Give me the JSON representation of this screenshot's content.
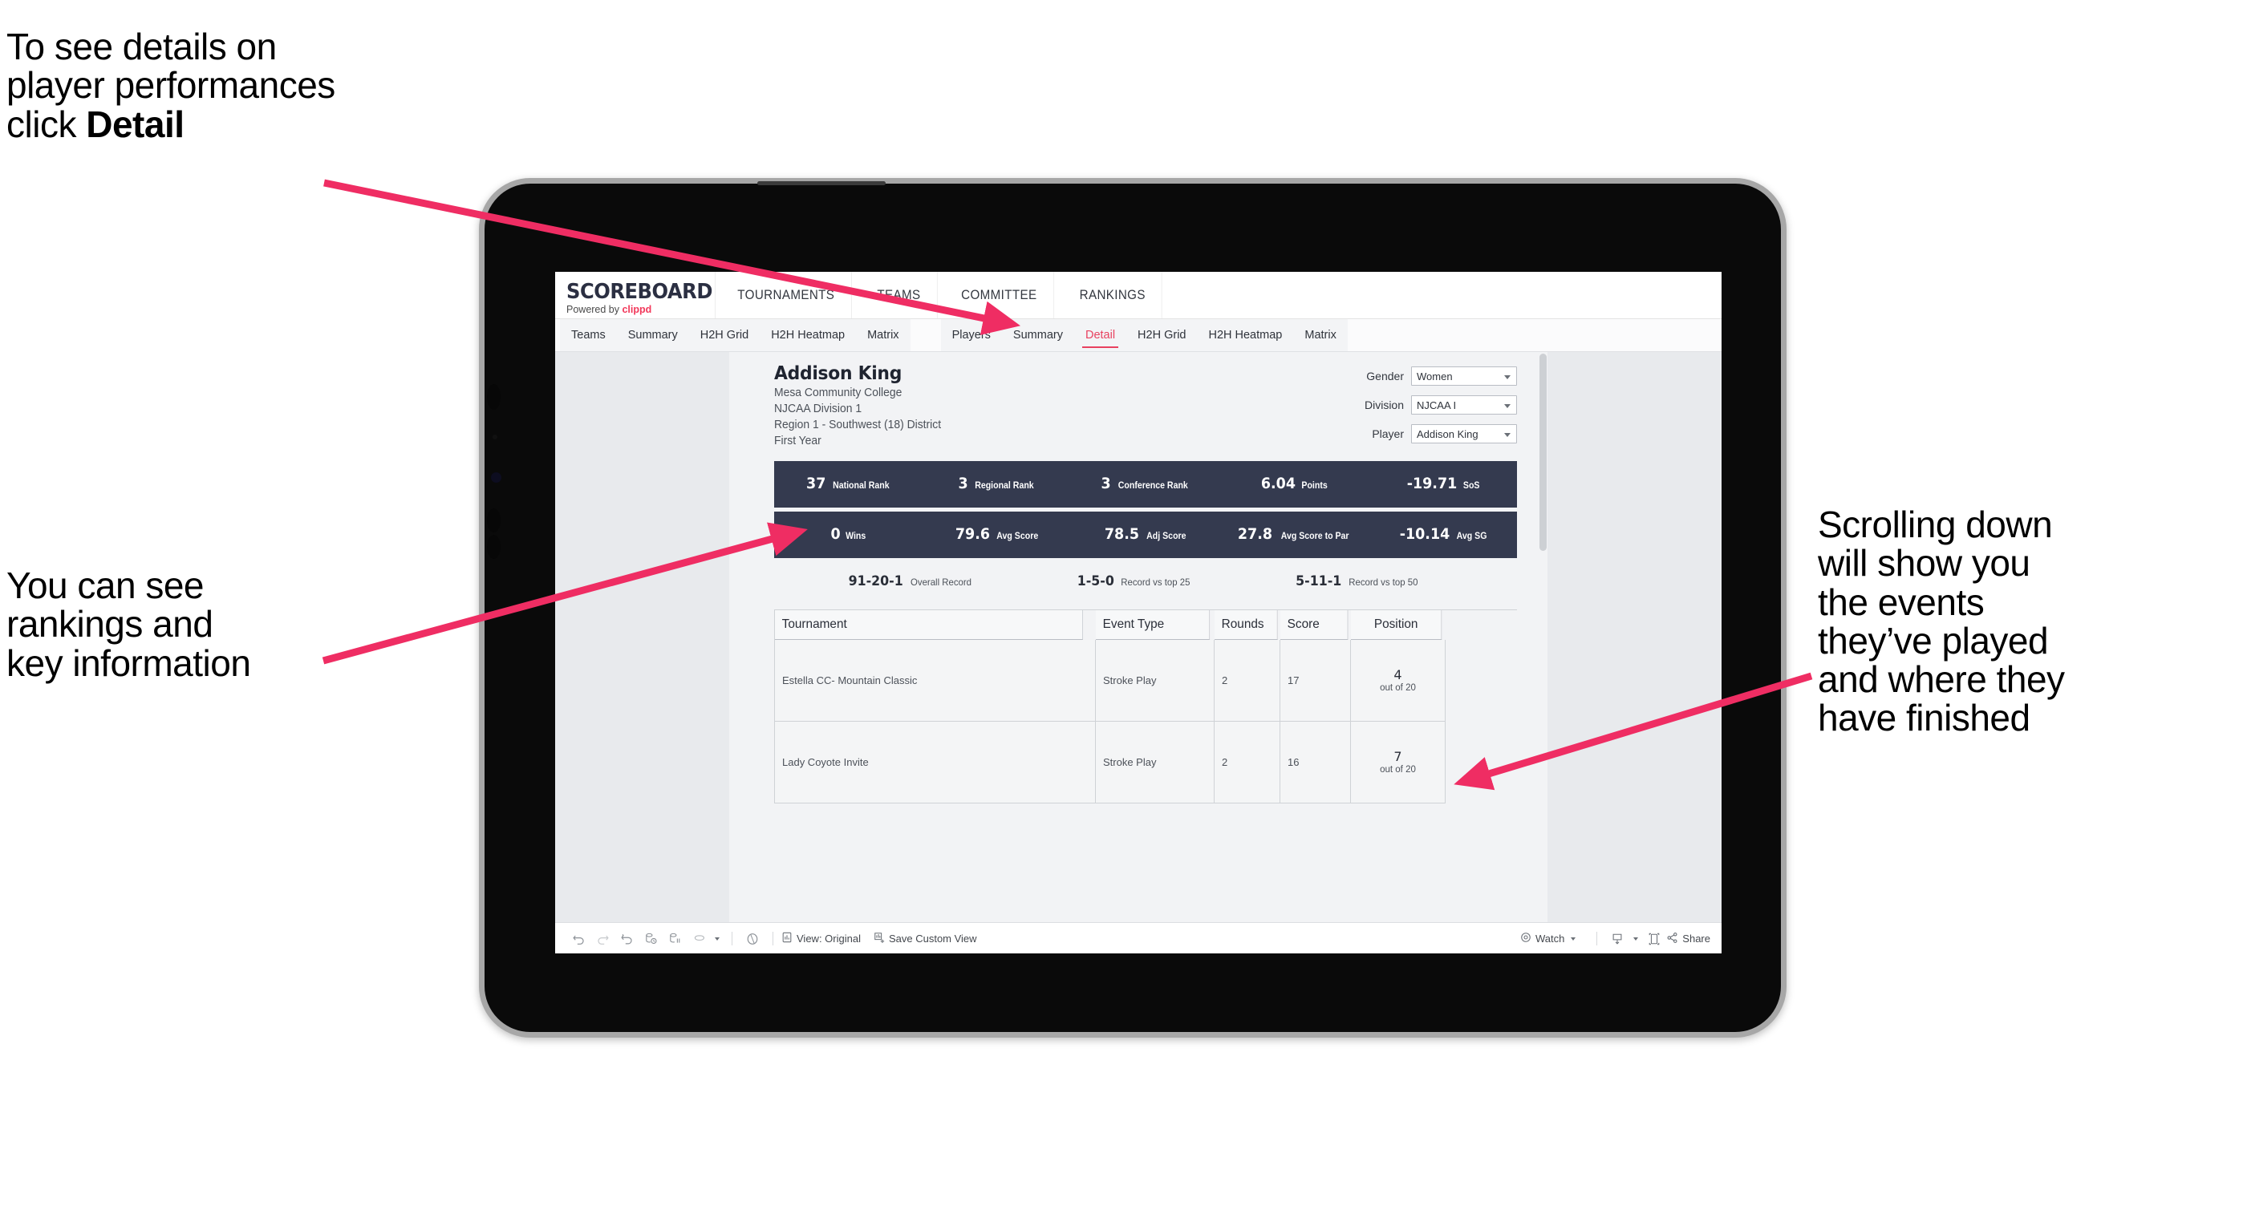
{
  "annotations": {
    "top_left": {
      "line1": "To see details on",
      "line2": "player performances",
      "line3_prefix": "click ",
      "line3_bold": "Detail"
    },
    "mid_left": {
      "line1": "You can see",
      "line2": "rankings and",
      "line3": "key information"
    },
    "right": {
      "line1": "Scrolling down",
      "line2": "will show you",
      "line3": "the events",
      "line4": "they’ve played",
      "line5": "and where they",
      "line6": "have finished"
    },
    "arrow_color": "#ef2d63"
  },
  "app": {
    "logo": {
      "wordmark": "SCOREBOARD",
      "powered_prefix": "Powered by ",
      "powered_brand": "clippd"
    },
    "top_nav": [
      {
        "label": "TOURNAMENTS"
      },
      {
        "label": "TEAMS"
      },
      {
        "label": "COMMITTEE"
      },
      {
        "label": "RANKINGS"
      }
    ],
    "sub_tabs_group1": [
      {
        "label": "Teams",
        "active": false
      },
      {
        "label": "Summary",
        "active": false
      },
      {
        "label": "H2H Grid",
        "active": false
      },
      {
        "label": "H2H Heatmap",
        "active": false
      },
      {
        "label": "Matrix",
        "active": false
      }
    ],
    "sub_tabs_group2": [
      {
        "label": "Players",
        "active": false
      },
      {
        "label": "Summary",
        "active": false
      },
      {
        "label": "Detail",
        "active": true
      },
      {
        "label": "H2H Grid",
        "active": false
      },
      {
        "label": "H2H Heatmap",
        "active": false
      },
      {
        "label": "Matrix",
        "active": false
      }
    ],
    "accent_color": "#e8415f",
    "stat_bar_color": "#343a4f"
  },
  "player": {
    "name": "Addison King",
    "school": "Mesa Community College",
    "division": "NJCAA Division 1",
    "region": "Region 1 - Southwest (18) District",
    "year": "First Year"
  },
  "filters": [
    {
      "label": "Gender",
      "value": "Women"
    },
    {
      "label": "Division",
      "value": "NJCAA I"
    },
    {
      "label": "Player",
      "value": "Addison King"
    }
  ],
  "stats_row1": [
    {
      "value": "37",
      "label": "National Rank"
    },
    {
      "value": "3",
      "label": "Regional Rank"
    },
    {
      "value": "3",
      "label": "Conference Rank"
    },
    {
      "value": "6.04",
      "label": "Points"
    },
    {
      "value": "-19.71",
      "label": "SoS"
    }
  ],
  "stats_row2": [
    {
      "value": "0",
      "label": "Wins"
    },
    {
      "value": "79.6",
      "label": "Avg Score"
    },
    {
      "value": "78.5",
      "label": "Adj Score"
    },
    {
      "value": "27.8",
      "label": "Avg Score to Par"
    },
    {
      "value": "-10.14",
      "label": "Avg SG"
    }
  ],
  "records": [
    {
      "value": "91-20-1",
      "label": "Overall Record"
    },
    {
      "value": "1-5-0",
      "label": "Record vs top 25"
    },
    {
      "value": "5-11-1",
      "label": "Record vs top 50"
    }
  ],
  "table": {
    "headers": [
      "Tournament",
      "Event Type",
      "Rounds",
      "Score",
      "Position"
    ],
    "rows": [
      {
        "tournament": "Estella CC- Mountain Classic",
        "event_type": "Stroke Play",
        "rounds": "2",
        "score": "17",
        "position": "4",
        "position_sub": "out of 20"
      },
      {
        "tournament": "Lady Coyote Invite",
        "event_type": "Stroke Play",
        "rounds": "2",
        "score": "16",
        "position": "7",
        "position_sub": "out of 20"
      }
    ]
  },
  "toolbar": {
    "icons": [
      "undo-icon",
      "redo-icon",
      "revert-icon",
      "refresh-data-icon",
      "pause-auto-update-icon",
      "auto-update-dropdown-icon"
    ],
    "view_original_label": "View: Original",
    "save_custom_view_label": "Save Custom View",
    "watch_label": "Watch",
    "share_label": "Share",
    "download_icon": "download-icon",
    "fullscreen_icon": "fullscreen-icon",
    "alerts_icon": "alerts-icon"
  }
}
